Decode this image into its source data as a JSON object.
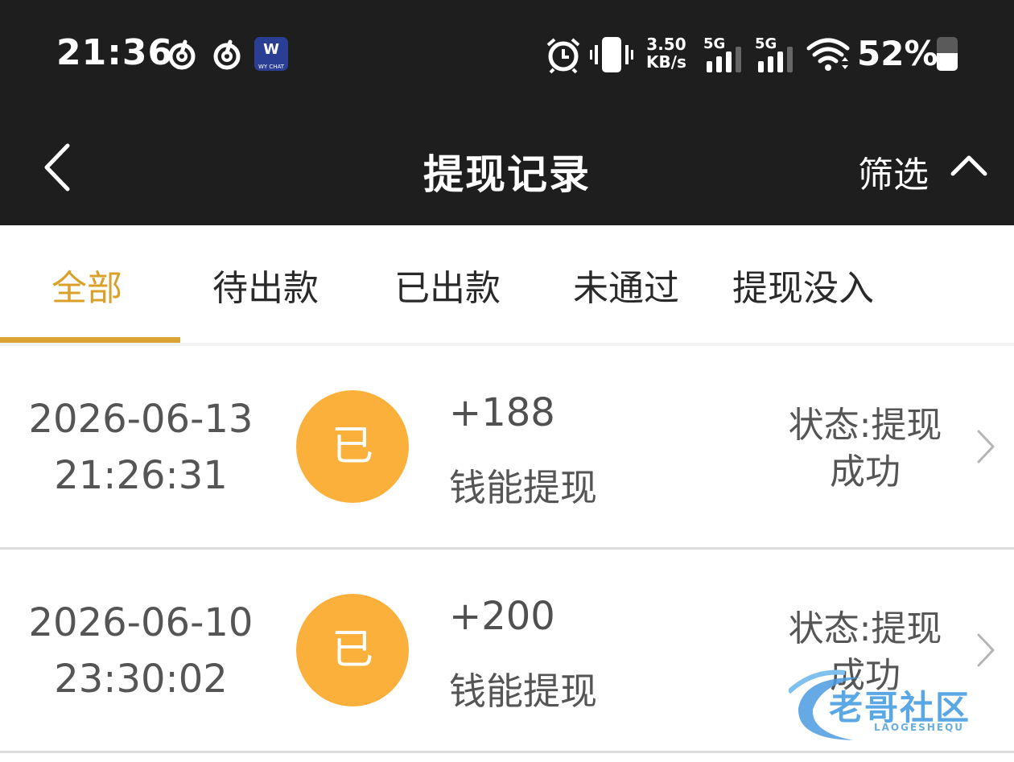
{
  "status_bar": {
    "time": "21:36",
    "app_badge_main": "W",
    "app_badge_sub": "WY CHAT",
    "speed_top": "3.50",
    "speed_bottom": "KB/s",
    "sim1": "5G",
    "sim2": "5G",
    "battery_text": "52%",
    "battery_level": 0.52,
    "icons": [
      "netease-music-icon",
      "netease-music-icon",
      "wy-chat-app-icon",
      "alarm-icon",
      "vibrate-icon",
      "signal-icon",
      "signal-icon",
      "wifi-icon",
      "battery-icon"
    ]
  },
  "header": {
    "title": "提现记录",
    "filter_label": "筛选",
    "back_icon": "chevron-left-icon",
    "filter_icon": "chevron-up-icon"
  },
  "tabs": [
    {
      "label": "全部",
      "active": true
    },
    {
      "label": "待出款",
      "active": false
    },
    {
      "label": "已出款",
      "active": false
    },
    {
      "label": "未通过",
      "active": false
    },
    {
      "label": "提现没入",
      "active": false
    }
  ],
  "records": [
    {
      "date": "2026-06-13",
      "time": "21:26:31",
      "badge": "已",
      "amount": "+188",
      "kind": "钱能提现",
      "status_line1": "状态:提现",
      "status_line2": "成功"
    },
    {
      "date": "2026-06-10",
      "time": "23:30:02",
      "badge": "已",
      "amount": "+200",
      "kind": "钱能提现",
      "status_line1": "状态:提现",
      "status_line2": "成功"
    }
  ],
  "watermark": {
    "text": "老哥社区",
    "sub": "LAOGESHEQU"
  },
  "colors": {
    "header_bg": "#1e1e1e",
    "accent": "#dba432",
    "badge": "#fbb03b"
  }
}
